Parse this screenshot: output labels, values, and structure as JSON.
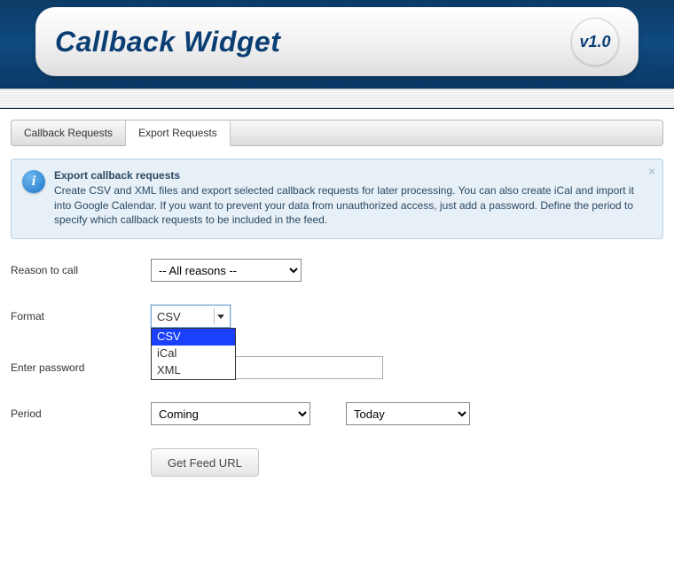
{
  "header": {
    "title": "Callback Widget",
    "version": "v1.0"
  },
  "tabs": {
    "callback_requests": "Callback Requests",
    "export_requests": "Export Requests"
  },
  "info": {
    "glyph": "i",
    "title": "Export callback requests",
    "body": "Create CSV and XML files and export selected callback requests for later processing. You can also create iCal and import it into Google Calendar. If you want to prevent your data from unauthorized access, just add a password. Define the period to specify which callback requests to be included in the feed.",
    "close": "×"
  },
  "form": {
    "reason": {
      "label": "Reason to call",
      "value": "-- All reasons --"
    },
    "format": {
      "label": "Format",
      "value": "CSV",
      "options": {
        "csv": "CSV",
        "ical": "iCal",
        "xml": "XML"
      }
    },
    "password": {
      "label": "Enter password",
      "value": ""
    },
    "period": {
      "label": "Period",
      "direction": "Coming",
      "range": "Today"
    },
    "submit": "Get Feed URL"
  }
}
